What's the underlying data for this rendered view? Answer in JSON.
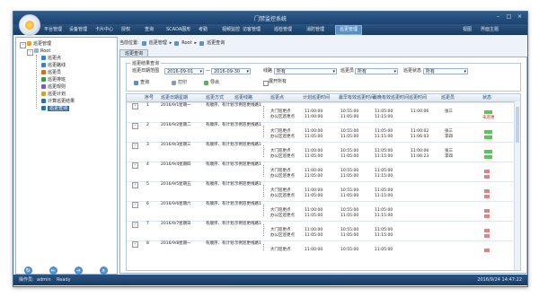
{
  "window": {
    "title": "门禁监控系统"
  },
  "menu": {
    "items": [
      "平台管理",
      "设备管理",
      "卡片中心",
      "授权",
      "查询",
      "SCADA图形",
      "考勤",
      "视频监控",
      "访客管理",
      "巡检管理",
      "消防管理",
      "巡更管理"
    ],
    "active_index": 11,
    "right": [
      "视图",
      "界面主题"
    ]
  },
  "sidebar": {
    "root": "巡更管理",
    "node": "Root",
    "items": [
      "巡更点",
      "巡更路线",
      "巡更员",
      "巡更排班",
      "巡更规则",
      "巡更计划",
      "计算巡更结果",
      "巡更查询"
    ],
    "selected_index": 7
  },
  "breadcrumb": [
    "当前位置:",
    "巡更管理",
    "Root",
    "巡更查询"
  ],
  "tab": {
    "label": "巡更查询"
  },
  "filters": {
    "title": "巡更结果查询",
    "date_label": "巡更日期范围",
    "date_from": "2016-09-01",
    "date_sep": "—",
    "date_to": "2016-09-30",
    "route_label": "线路",
    "route_value": "所有",
    "guard_label": "巡更员",
    "guard_value": "所有",
    "status_label": "巡更状态",
    "status_value": "所有",
    "btn_query": "查询",
    "btn_print": "打印",
    "btn_export": "导出",
    "show_all_label": "展开所有"
  },
  "grid": {
    "headers": [
      "序号",
      "巡更日期",
      "星期",
      "巡更方式",
      "巡更线路",
      "巡更点",
      "计划巡更时间",
      "最早有效巡更时间",
      "最晚有效巡更时间",
      "巡更时间",
      "巡更员",
      "状态"
    ],
    "rows": [
      {
        "no": "1",
        "date": "2016/9/1",
        "weekday": "星期一",
        "mode": "有顺序、有计划",
        "route": "示例巡更线路1",
        "subs": [
          {
            "point": "大门巡更点",
            "plan": "11:00:00",
            "earliest": "10:55:00",
            "latest": "11:05:00",
            "actual": "11:00:06",
            "guard": "张三",
            "status": "green"
          },
          {
            "point": "办公区巡更点",
            "plan": "11:00:00",
            "earliest": "11:05:00",
            "latest": "11:15:00",
            "actual": "",
            "guard": "",
            "status": "未巡更"
          }
        ]
      },
      {
        "no": "2",
        "date": "2016/9/2",
        "weekday": "星期二",
        "mode": "有顺序、有计划",
        "route": "示例巡更线路1",
        "subs": [
          {
            "point": "大门巡更点",
            "plan": "11:00:00",
            "earliest": "10:55:00",
            "latest": "11:05:00",
            "actual": "11:00:02",
            "guard": "张三",
            "status": "green"
          },
          {
            "point": "办公区巡更点",
            "plan": "11:05:00",
            "earliest": "11:05:00",
            "latest": "11:15:00",
            "actual": "11:06:03",
            "guard": "李四",
            "status": "green"
          }
        ]
      },
      {
        "no": "3",
        "date": "2016/9/3",
        "weekday": "星期三",
        "mode": "有顺序、有计划",
        "route": "示例巡更线路1",
        "subs": [
          {
            "point": "大门巡更点",
            "plan": "11:00:00",
            "earliest": "10:55:00",
            "latest": "11:05:00",
            "actual": "11:00:06",
            "guard": "张三",
            "status": "green"
          },
          {
            "point": "办公区巡更点",
            "plan": "11:05:00",
            "earliest": "11:05:00",
            "latest": "11:15:00",
            "actual": "11:06:23",
            "guard": "李四",
            "status": "green"
          }
        ]
      },
      {
        "no": "4",
        "date": "2016/9/4",
        "weekday": "星期四",
        "mode": "有顺序、有计划",
        "route": "示例巡更线路1",
        "subs": [
          {
            "point": "大门巡更点",
            "plan": "11:00:00",
            "earliest": "10:55:00",
            "latest": "11:05:00",
            "actual": "",
            "guard": "",
            "status": "red"
          },
          {
            "point": "办公区巡更点",
            "plan": "11:05:00",
            "earliest": "11:05:00",
            "latest": "11:15:00",
            "actual": "",
            "guard": "",
            "status": "red"
          }
        ]
      },
      {
        "no": "5",
        "date": "2016/9/5",
        "weekday": "星期五",
        "mode": "有顺序、有计划",
        "route": "示例巡更线路1",
        "subs": [
          {
            "point": "大门巡更点",
            "plan": "11:00:00",
            "earliest": "10:55:00",
            "latest": "11:05:00",
            "actual": "",
            "guard": "",
            "status": "red"
          },
          {
            "point": "办公区巡更点",
            "plan": "11:05:00",
            "earliest": "11:05:00",
            "latest": "11:15:00",
            "actual": "",
            "guard": "",
            "status": "red"
          }
        ]
      },
      {
        "no": "6",
        "date": "2016/9/6",
        "weekday": "星期六",
        "mode": "有顺序、有计划",
        "route": "示例巡更线路1",
        "subs": [
          {
            "point": "大门巡更点",
            "plan": "11:00:00",
            "earliest": "10:55:00",
            "latest": "11:05:00",
            "actual": "",
            "guard": "",
            "status": "red"
          },
          {
            "point": "办公区巡更点",
            "plan": "11:05:00",
            "earliest": "11:05:00",
            "latest": "11:15:00",
            "actual": "",
            "guard": "",
            "status": "red"
          }
        ]
      },
      {
        "no": "7",
        "date": "2016/9/7",
        "weekday": "星期日",
        "mode": "有顺序、有计划",
        "route": "示例巡更线路1",
        "subs": [
          {
            "point": "大门巡更点",
            "plan": "11:00:00",
            "earliest": "10:55:00",
            "latest": "11:05:00",
            "actual": "",
            "guard": "",
            "status": "red"
          },
          {
            "point": "办公区巡更点",
            "plan": "11:05:00",
            "earliest": "11:05:00",
            "latest": "11:15:00",
            "actual": "",
            "guard": "",
            "status": "red"
          }
        ]
      },
      {
        "no": "8",
        "date": "2016/9/8",
        "weekday": "星期一",
        "mode": "有顺序、有计划",
        "route": "示例巡更线路1",
        "subs": [
          {
            "point": "大门巡更点",
            "plan": "11:00:00",
            "earliest": "10:55:00",
            "latest": "11:05:00",
            "actual": "",
            "guard": "",
            "status": "red"
          }
        ]
      }
    ]
  },
  "statusbar": {
    "user_label": "操作员:",
    "user": "admin",
    "state": "Ready",
    "datetime": "2016/9/24 14:47:22"
  },
  "colors": {
    "accent": "#3d6fa6",
    "ok": "#59c659",
    "bad": "#c21f1f",
    "titlebar": "#1c4270"
  }
}
